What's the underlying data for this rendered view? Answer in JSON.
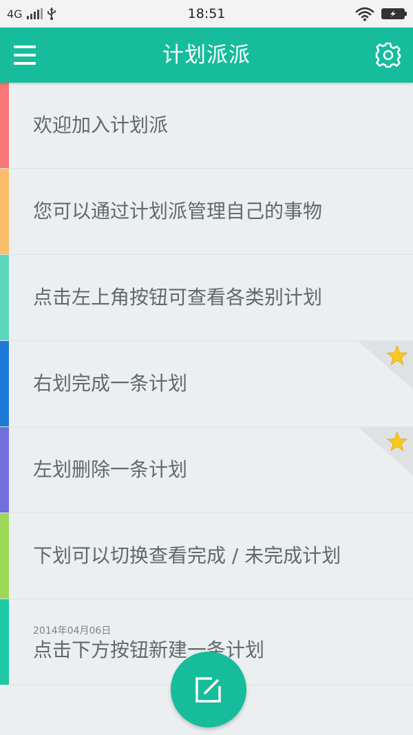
{
  "status_bar": {
    "network": "4G",
    "time": "18:51"
  },
  "app_bar": {
    "title": "计划派派",
    "menu_icon": "hamburger-menu-icon",
    "settings_icon": "gear-icon"
  },
  "plans": [
    {
      "text": "欢迎加入计划派",
      "color": "#f87675",
      "starred": false,
      "date": ""
    },
    {
      "text": "您可以通过计划派管理自己的事物",
      "color": "#fbbd6c",
      "starred": false,
      "date": ""
    },
    {
      "text": "点击左上角按钮可查看各类别计划",
      "color": "#5ad8bd",
      "starred": false,
      "date": ""
    },
    {
      "text": "右划完成一条计划",
      "color": "#1e79d6",
      "starred": true,
      "date": ""
    },
    {
      "text": "左划删除一条计划",
      "color": "#7070dc",
      "starred": true,
      "date": ""
    },
    {
      "text": "下划可以切换查看完成 / 未完成计划",
      "color": "#9ed858",
      "starred": false,
      "date": ""
    },
    {
      "text": "点击下方按钮新建一条计划",
      "color": "#1dc9a4",
      "starred": false,
      "date": "2014年04月06日"
    }
  ],
  "fab": {
    "icon": "edit-note-icon"
  },
  "colors": {
    "accent": "#16bc9c",
    "star": "#f8c81e"
  }
}
